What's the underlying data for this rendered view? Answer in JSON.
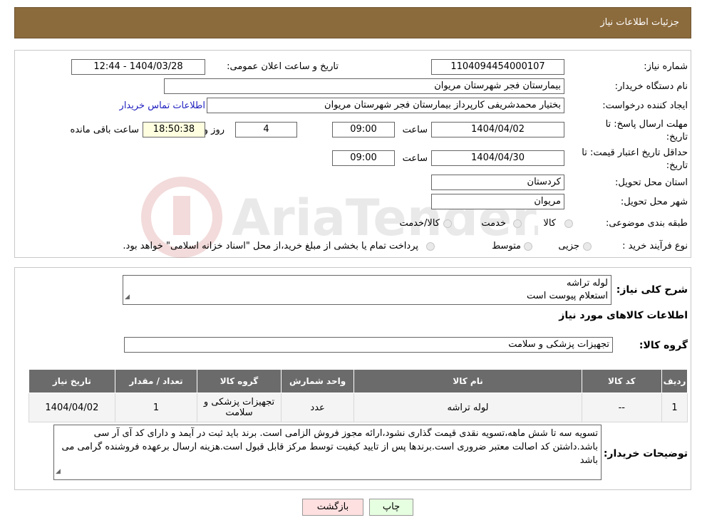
{
  "header": {
    "title": "جزئیات اطلاعات نیاز"
  },
  "form": {
    "need_number_label": "شماره نیاز:",
    "need_number": "1104094454000107",
    "announce_label": "تاریخ و ساعت اعلان عمومی:",
    "announce_value": "1404/03/28 - 12:44",
    "buyer_org_label": "نام دستگاه خریدار:",
    "buyer_org": "بیمارستان فجر شهرستان مریوان",
    "creator_label": "ایجاد کننده درخواست:",
    "creator": "بختیار محمدشریفی کارپرداز بیمارستان فجر شهرستان مریوان",
    "contact_link": "اطلاعات تماس خریدار",
    "reply_deadline_label_1": "مهلت ارسال پاسخ: تا",
    "reply_deadline_label_2": "تاریخ:",
    "reply_date": "1404/04/02",
    "time_label": "ساعت",
    "reply_time": "09:00",
    "days_value": "4",
    "days_label": "روز و",
    "remaining_time": "18:50:38",
    "remaining_label": "ساعت باقی مانده",
    "validity_label_1": "حداقل تاریخ اعتبار قیمت: تا",
    "validity_label_2": "تاریخ:",
    "validity_date": "1404/04/30",
    "validity_time": "09:00",
    "province_label": "استان محل تحویل:",
    "province": "کردستان",
    "city_label": "شهر محل تحویل:",
    "city": "مریوان",
    "category_label": "طبقه بندی موضوعی:",
    "category_options": [
      "کالا",
      "خدمت",
      "کالا/خدمت"
    ],
    "process_label": "نوع فرآیند خرید :",
    "process_options": [
      "جزیی",
      "متوسط"
    ],
    "process_note": "پرداخت تمام یا بخشی از مبلغ خرید،از محل \"اسناد خزانه اسلامی\" خواهد بود."
  },
  "summary": {
    "label": "شرح کلی نیاز:",
    "line1": "لوله تراشه",
    "line2": "استعلام پیوست است"
  },
  "goods_info_title": "اطلاعات کالاهای مورد نیاز",
  "goods_group": {
    "label": "گروه کالا:",
    "value": "تجهیزات پزشکی و سلامت"
  },
  "table": {
    "headers": [
      "ردیف",
      "کد کالا",
      "نام کالا",
      "واحد شمارش",
      "گروه کالا",
      "تعداد / مقدار",
      "تاریخ نیاز"
    ],
    "rows": [
      [
        "1",
        "--",
        "لوله تراشه",
        "عدد",
        "تجهیزات پزشکی و سلامت",
        "1",
        "1404/04/02"
      ]
    ]
  },
  "buyer_notes": {
    "label": "توضیحات خریدار:",
    "text": "تسویه سه تا شش ماهه،تسویه نقدی قیمت گذاری نشود،ارائه مجوز فروش الزامی است. برند باید ثبت در آیمد و دارای کد آی آر سی باشد.داشتن کد اصالت معتبر ضروری است.برندها پس از تایید کیفیت توسط مرکز قابل قبول است.هزینه ارسال برعهده فروشنده گرامی می باشد"
  },
  "buttons": {
    "print": "چاپ",
    "back": "بازگشت"
  },
  "colors": {
    "header_bg": "#8b6a3c",
    "table_header": "#6b6b6b",
    "print_bg": "#e6ffe0",
    "back_bg": "#ffe0e0"
  },
  "watermark": "AriaTender.neT"
}
